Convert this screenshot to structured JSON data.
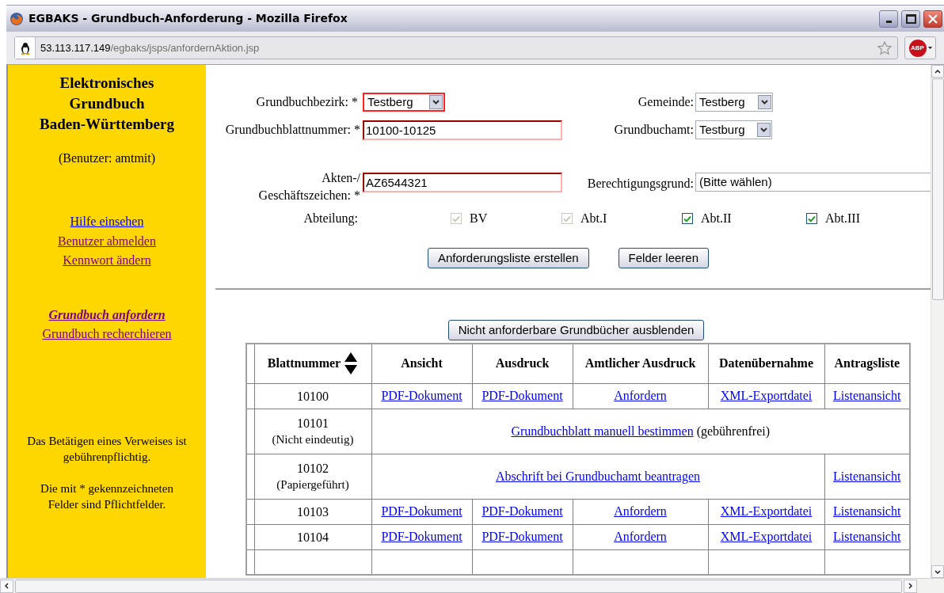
{
  "window": {
    "title": "EGBAKS - Grundbuch-Anforderung - Mozilla Firefox"
  },
  "toolbar": {
    "url_host": "53.113.117.149",
    "url_path": "/egbaks/jsps/anfordernAktion.jsp",
    "addon_label": "ABP"
  },
  "sidebar": {
    "title": [
      "Elektronisches",
      "Grundbuch",
      "Baden-Württemberg"
    ],
    "user": "(Benutzer: amtmit)",
    "links": [
      {
        "label": "Hilfe einsehen",
        "visited": false,
        "selected": false
      },
      {
        "label": "Benutzer abmelden",
        "visited": true,
        "selected": false
      },
      {
        "label": "Kennwort ändern",
        "visited": true,
        "selected": false
      }
    ],
    "nav": [
      {
        "label": "Grundbuch anfordern",
        "visited": true,
        "selected": true
      },
      {
        "label": "Grundbuch recherchieren",
        "visited": true,
        "selected": false
      }
    ],
    "notes": [
      "Das Betätigen eines Verweises ist gebührenpflichtig.",
      "Die mit * gekennzeichneten Felder sind Pflichtfelder."
    ]
  },
  "form": {
    "grundbuchbezirk": {
      "label": "Grundbuchbezirk: *",
      "value": "Testberg",
      "error": true
    },
    "gemeinde": {
      "label": "Gemeinde:",
      "value": "Testberg"
    },
    "blattnummer": {
      "label": "Grundbuchblattnummer: *",
      "value": "10100-10125",
      "error": true
    },
    "grundbuchamt": {
      "label": "Grundbuchamt:",
      "value": "Testburg"
    },
    "aktenzeichen": {
      "label_lines": [
        "Akten-/",
        "Geschäftszeichen: *"
      ],
      "value": "AZ6544321",
      "error": true
    },
    "berechtigungsgrund": {
      "label": "Berechtigungsgrund:",
      "value": "(Bitte wählen)"
    },
    "abteilung": {
      "label": "Abteilung:",
      "options": [
        {
          "label": "BV",
          "checked": true,
          "disabled": true
        },
        {
          "label": "Abt.I",
          "checked": true,
          "disabled": true
        },
        {
          "label": "Abt.II",
          "checked": true,
          "disabled": false
        },
        {
          "label": "Abt.III",
          "checked": true,
          "disabled": false
        }
      ]
    },
    "buttons": [
      "Anforderungsliste erstellen",
      "Felder leeren"
    ]
  },
  "hide_button": "Nicht anforderbare Grundbücher ausblenden",
  "table": {
    "columns": [
      "Blattnummer",
      "Ansicht",
      "Ausdruck",
      "Amtlicher Ausdruck",
      "Datenübernahme",
      "Antragsliste"
    ],
    "rows": [
      {
        "kind": "full",
        "number": "10100",
        "cells": [
          "PDF-Dokument",
          "PDF-Dokument",
          "Anfordern",
          "XML-Exportdatei",
          "Listenansicht"
        ]
      },
      {
        "kind": "manual",
        "number": "10101",
        "note": "(Nicht eindeutig)",
        "link": "Grundbuchblatt manuell bestimmen",
        "suffix": "(gebührenfrei)"
      },
      {
        "kind": "paper",
        "number": "10102",
        "note": "(Papiergeführt)",
        "link": "Abschrift bei Grundbuchamt beantragen",
        "last": "Listenansicht"
      },
      {
        "kind": "full",
        "number": "10103",
        "cells": [
          "PDF-Dokument",
          "PDF-Dokument",
          "Anfordern",
          "XML-Exportdatei",
          "Listenansicht"
        ]
      },
      {
        "kind": "full",
        "number": "10104",
        "cells": [
          "PDF-Dokument",
          "PDF-Dokument",
          "Anfordern",
          "XML-Exportdatei",
          "Listenansicht"
        ]
      }
    ]
  }
}
